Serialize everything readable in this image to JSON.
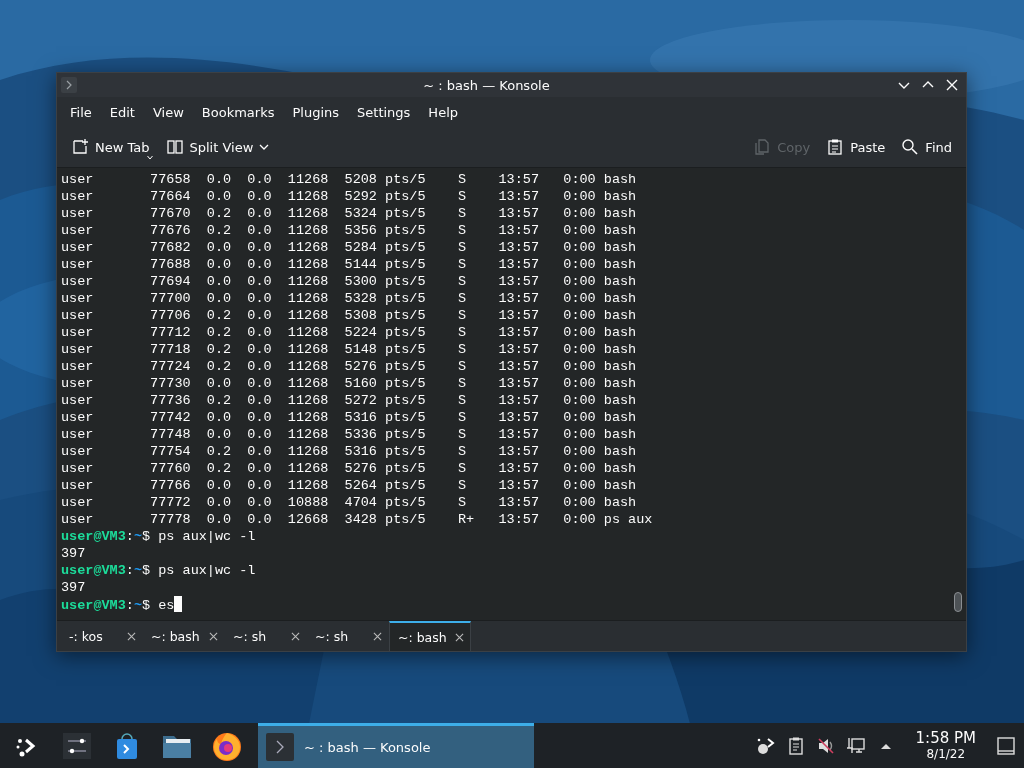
{
  "window": {
    "title": "~ : bash — Konsole"
  },
  "menu": [
    "File",
    "Edit",
    "View",
    "Bookmarks",
    "Plugins",
    "Settings",
    "Help"
  ],
  "toolbar_left": [
    {
      "label": "New Tab",
      "disabled": false
    },
    {
      "label": "Split View",
      "disabled": false
    }
  ],
  "toolbar_right": [
    {
      "label": "Copy",
      "disabled": true
    },
    {
      "label": "Paste",
      "disabled": false
    },
    {
      "label": "Find",
      "disabled": false
    }
  ],
  "terminal": {
    "lines": [
      {
        "kind": "output",
        "text": "user       77658  0.0  0.0  11268  5208 pts/5    S    13:57   0:00 bash"
      },
      {
        "kind": "output",
        "text": "user       77664  0.0  0.0  11268  5292 pts/5    S    13:57   0:00 bash"
      },
      {
        "kind": "output",
        "text": "user       77670  0.2  0.0  11268  5324 pts/5    S    13:57   0:00 bash"
      },
      {
        "kind": "output",
        "text": "user       77676  0.2  0.0  11268  5356 pts/5    S    13:57   0:00 bash"
      },
      {
        "kind": "output",
        "text": "user       77682  0.0  0.0  11268  5284 pts/5    S    13:57   0:00 bash"
      },
      {
        "kind": "output",
        "text": "user       77688  0.0  0.0  11268  5144 pts/5    S    13:57   0:00 bash"
      },
      {
        "kind": "output",
        "text": "user       77694  0.0  0.0  11268  5300 pts/5    S    13:57   0:00 bash"
      },
      {
        "kind": "output",
        "text": "user       77700  0.0  0.0  11268  5328 pts/5    S    13:57   0:00 bash"
      },
      {
        "kind": "output",
        "text": "user       77706  0.2  0.0  11268  5308 pts/5    S    13:57   0:00 bash"
      },
      {
        "kind": "output",
        "text": "user       77712  0.2  0.0  11268  5224 pts/5    S    13:57   0:00 bash"
      },
      {
        "kind": "output",
        "text": "user       77718  0.2  0.0  11268  5148 pts/5    S    13:57   0:00 bash"
      },
      {
        "kind": "output",
        "text": "user       77724  0.2  0.0  11268  5276 pts/5    S    13:57   0:00 bash"
      },
      {
        "kind": "output",
        "text": "user       77730  0.0  0.0  11268  5160 pts/5    S    13:57   0:00 bash"
      },
      {
        "kind": "output",
        "text": "user       77736  0.2  0.0  11268  5272 pts/5    S    13:57   0:00 bash"
      },
      {
        "kind": "output",
        "text": "user       77742  0.0  0.0  11268  5316 pts/5    S    13:57   0:00 bash"
      },
      {
        "kind": "output",
        "text": "user       77748  0.0  0.0  11268  5336 pts/5    S    13:57   0:00 bash"
      },
      {
        "kind": "output",
        "text": "user       77754  0.2  0.0  11268  5316 pts/5    S    13:57   0:00 bash"
      },
      {
        "kind": "output",
        "text": "user       77760  0.2  0.0  11268  5276 pts/5    S    13:57   0:00 bash"
      },
      {
        "kind": "output",
        "text": "user       77766  0.0  0.0  11268  5264 pts/5    S    13:57   0:00 bash"
      },
      {
        "kind": "output",
        "text": "user       77772  0.0  0.0  10888  4704 pts/5    S    13:57   0:00 bash"
      },
      {
        "kind": "output",
        "text": "user       77778  0.0  0.0  12668  3428 pts/5    R+   13:57   0:00 ps aux"
      },
      {
        "kind": "prompt",
        "host": "user@VM3",
        "sep": ":",
        "path": "~",
        "command": "$ ps aux|wc -l",
        "cursor": false
      },
      {
        "kind": "output",
        "text": "397"
      },
      {
        "kind": "prompt",
        "host": "user@VM3",
        "sep": ":",
        "path": "~",
        "command": "$ ps aux|wc -l",
        "cursor": false
      },
      {
        "kind": "output",
        "text": "397"
      },
      {
        "kind": "prompt",
        "host": "user@VM3",
        "sep": ":",
        "path": "~",
        "command": "$ es",
        "cursor": true
      }
    ]
  },
  "tabs": [
    {
      "label": "-: kos",
      "selected": false
    },
    {
      "label": "~: bash",
      "selected": false
    },
    {
      "label": "~: sh",
      "selected": false
    },
    {
      "label": "~: sh",
      "selected": false
    },
    {
      "label": "~: bash",
      "selected": true
    }
  ],
  "taskbar": {
    "tasks": [
      {
        "title": "~ : bash — Konsole",
        "active": true
      }
    ],
    "clock": {
      "time": "1:58 PM",
      "date": "8/1/22"
    }
  }
}
